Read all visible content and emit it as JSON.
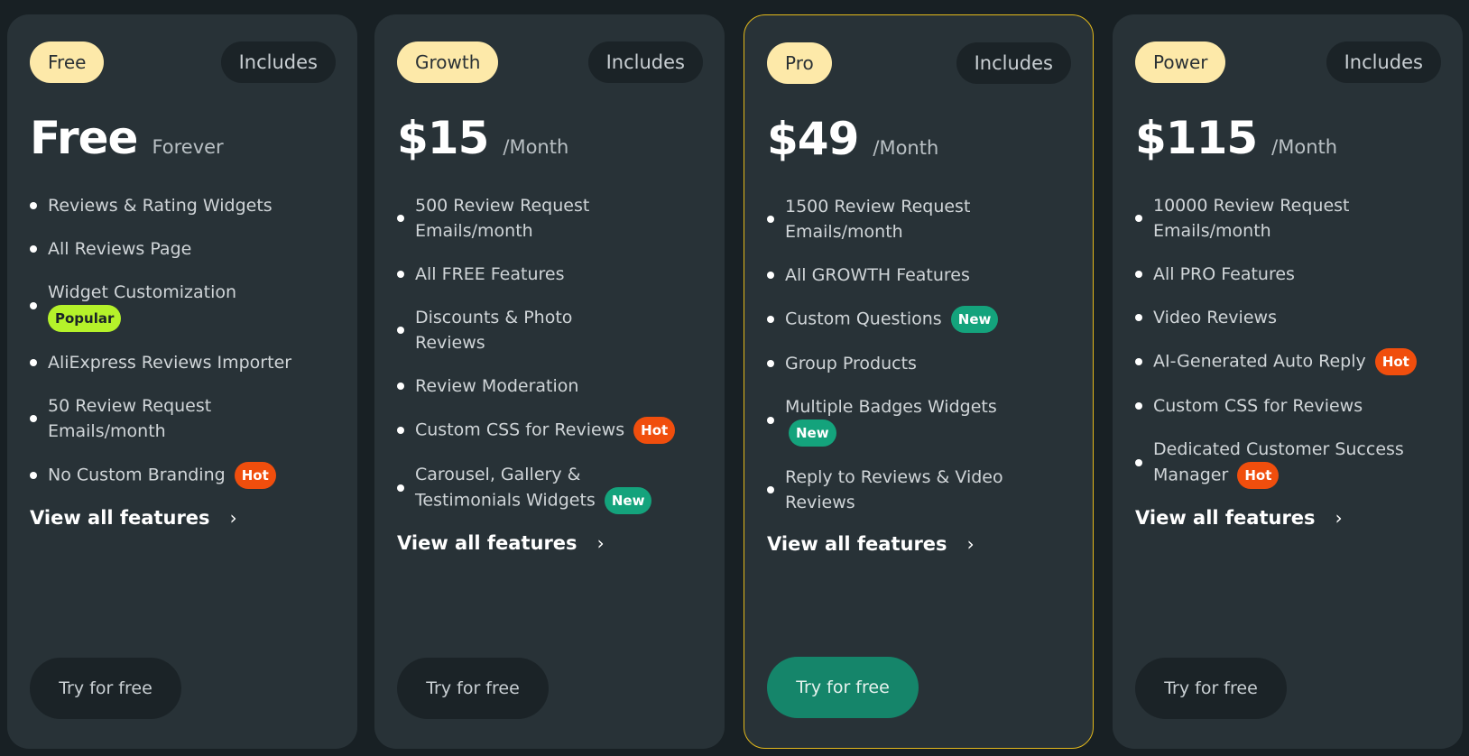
{
  "colors": {
    "background": "#182024",
    "card": "#283237",
    "tier_pill": "#fde9a9",
    "featured_border": "#e3b91b",
    "cta_featured": "#15856a",
    "hot": "#f04e0d",
    "new": "#14a37c",
    "popular": "#b5f22a"
  },
  "plans": [
    {
      "tier": "Free",
      "includes": "Includes",
      "amount": "Free",
      "period": "Forever",
      "featured": false,
      "features": [
        {
          "text": "Reviews & Rating Widgets"
        },
        {
          "text": "All Reviews Page"
        },
        {
          "text": "Widget Customization",
          "badge": "Popular",
          "badge_type": "pop",
          "badge_block": true
        },
        {
          "text": "AliExpress Reviews Importer"
        },
        {
          "text": "50 Review Request Emails/month"
        },
        {
          "text": "No Custom Branding",
          "badge": "Hot",
          "badge_type": "hot"
        }
      ],
      "view_all": "View all features",
      "cta": "Try for free"
    },
    {
      "tier": "Growth",
      "includes": "Includes",
      "amount": "$15",
      "period": "/Month",
      "featured": false,
      "features": [
        {
          "text": "500 Review Request Emails/month"
        },
        {
          "text": "All FREE Features"
        },
        {
          "text": "Discounts & Photo Reviews"
        },
        {
          "text": "Review Moderation"
        },
        {
          "text": "Custom CSS for Reviews",
          "badge": "Hot",
          "badge_type": "hot"
        },
        {
          "text": "Carousel, Gallery & Testimonials Widgets",
          "badge": "New",
          "badge_type": "new"
        }
      ],
      "view_all": "View all features",
      "cta": "Try for free"
    },
    {
      "tier": "Pro",
      "includes": "Includes",
      "amount": "$49",
      "period": "/Month",
      "featured": true,
      "features": [
        {
          "text": "1500 Review Request Emails/month"
        },
        {
          "text": "All GROWTH Features"
        },
        {
          "text": "Custom Questions",
          "badge": "New",
          "badge_type": "new"
        },
        {
          "text": "Group Products"
        },
        {
          "text": "Multiple Badges Widgets",
          "badge": "New",
          "badge_type": "new",
          "badge_block": true
        },
        {
          "text": "Reply to Reviews & Video Reviews"
        }
      ],
      "view_all": "View all features",
      "cta": "Try for free"
    },
    {
      "tier": "Power",
      "includes": "Includes",
      "amount": "$115",
      "period": "/Month",
      "featured": false,
      "features": [
        {
          "text": "10000 Review Request Emails/month"
        },
        {
          "text": "All PRO Features"
        },
        {
          "text": "Video Reviews"
        },
        {
          "text": "AI-Generated Auto Reply",
          "badge": "Hot",
          "badge_type": "hot"
        },
        {
          "text": "Custom CSS for Reviews"
        },
        {
          "text": "Dedicated Customer Success Manager",
          "badge": "Hot",
          "badge_type": "hot"
        }
      ],
      "view_all": "View all features",
      "cta": "Try for free"
    }
  ]
}
